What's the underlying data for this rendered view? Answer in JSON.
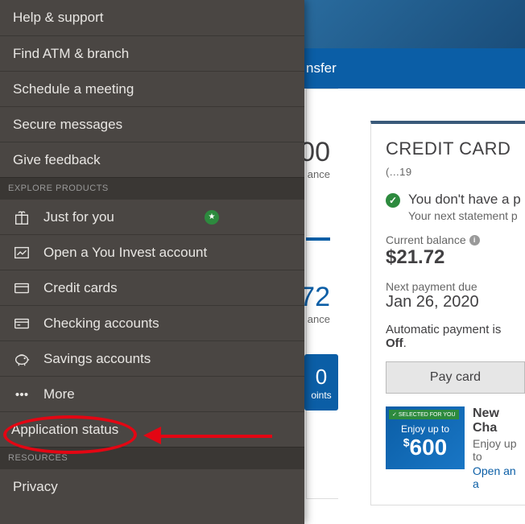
{
  "nav": {
    "visible_label": "nsfer"
  },
  "left_card": {
    "num1": "00",
    "num1_label": "ance",
    "num2": "72",
    "num2_label": "ance",
    "points_value": "0",
    "points_label": "oints"
  },
  "credit_card": {
    "title": "CREDIT CARD",
    "title_suffix": "(...19",
    "status_text": "You don't have a p",
    "status_sub": "Your next statement p",
    "current_balance_label": "Current balance",
    "current_balance_value": "$21.72",
    "next_payment_label": "Next payment due",
    "next_payment_value": "Jan 26, 2020",
    "auto_prefix": "Automatic payment is ",
    "auto_value": "Off",
    "auto_suffix": ".",
    "pay_button": "Pay card",
    "promo": {
      "badge": "SELECTED FOR YOU",
      "enjoy": "Enjoy up to",
      "amount_currency": "$",
      "amount": "600",
      "title": "New Cha",
      "sub": "Enjoy up to",
      "link": "Open an a"
    }
  },
  "sidebar": {
    "top_items": [
      "Help & support",
      "Find ATM & branch",
      "Schedule a meeting",
      "Secure messages",
      "Give feedback"
    ],
    "section_explore": "EXPLORE PRODUCTS",
    "explore_items": [
      {
        "label": "Just for you",
        "icon": "gift",
        "badge": true
      },
      {
        "label": "Open a You Invest account",
        "icon": "chart",
        "badge": false
      },
      {
        "label": "Credit cards",
        "icon": "card",
        "badge": false
      },
      {
        "label": "Checking accounts",
        "icon": "check-card",
        "badge": false
      },
      {
        "label": "Savings accounts",
        "icon": "piggy",
        "badge": false
      },
      {
        "label": "More",
        "icon": "dots",
        "badge": false
      }
    ],
    "application_status": "Application status",
    "section_resources": "RESOURCES",
    "resources_items": [
      "Privacy"
    ]
  }
}
